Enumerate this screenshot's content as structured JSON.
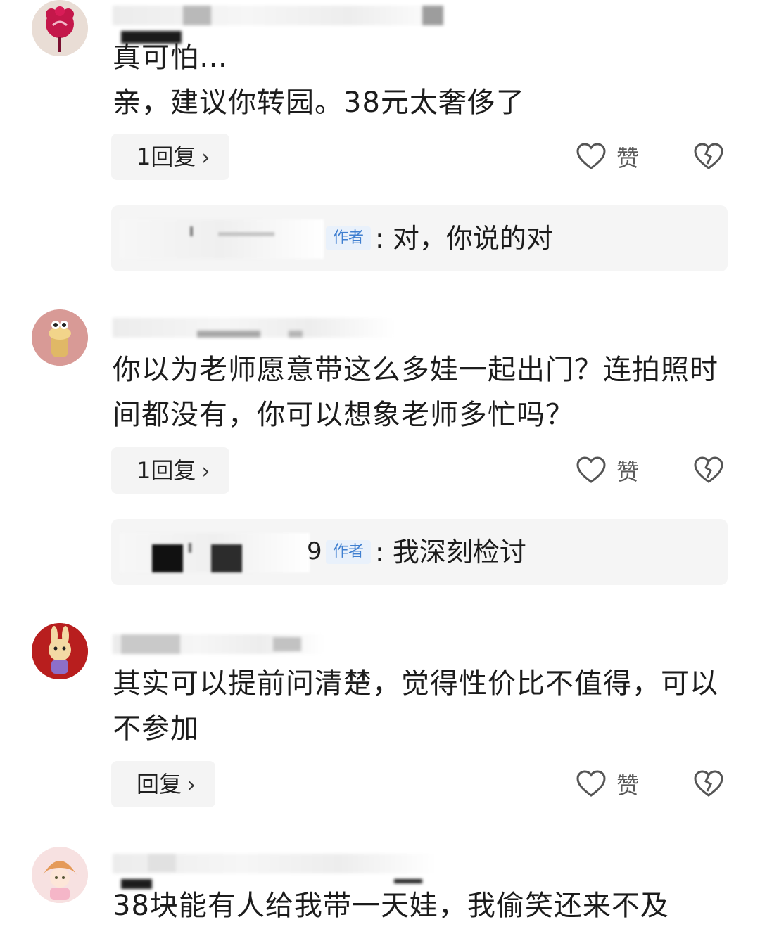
{
  "labels": {
    "like": "赞",
    "author_tag": "作者"
  },
  "comments": [
    {
      "text": "真可怕…\n亲，建议你转园。38元太奢侈了",
      "reply_button": "1回复",
      "sub_reply": {
        "prefix": "",
        "text": ": 对，你说的对"
      }
    },
    {
      "text": "你以为老师愿意带这么多娃一起出门？连拍照时间都没有，你可以想象老师多忙吗？",
      "reply_button": "1回复",
      "sub_reply": {
        "prefix": "9",
        "text": ": 我深刻检讨"
      }
    },
    {
      "text": "其实可以提前问清楚，觉得性价比不值得，可以不参加",
      "reply_button": "回复"
    },
    {
      "text": "38块能有人给我带一天娃，我偷笑还来不及"
    }
  ],
  "icons": {
    "chevron": "›",
    "like": "heart-outline-icon",
    "dislike": "broken-heart-icon"
  },
  "colors": {
    "author_tag_bg": "#e9f1fb",
    "author_tag_text": "#3f7fd0",
    "reply_bg": "#f4f4f4"
  }
}
